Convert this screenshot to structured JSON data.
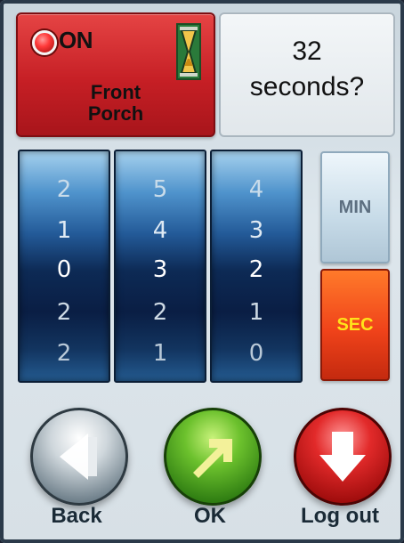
{
  "status": {
    "state_label": "ON",
    "device_name_line1": "Front",
    "device_name_line2": "Porch",
    "power_icon": "power-indicator-icon",
    "timer_icon": "hourglass-icon"
  },
  "question": {
    "line1": "32",
    "line2": "seconds?"
  },
  "wheels": [
    {
      "digits": [
        "2",
        "1",
        "0",
        "2",
        "2"
      ],
      "selected": "0"
    },
    {
      "digits": [
        "5",
        "4",
        "3",
        "2",
        "1"
      ],
      "selected": "3"
    },
    {
      "digits": [
        "4",
        "3",
        "2",
        "1",
        "0"
      ],
      "selected": "2"
    }
  ],
  "units": {
    "min_label": "MIN",
    "sec_label": "SEC",
    "active": "SEC"
  },
  "actions": {
    "back_label": "Back",
    "ok_label": "OK",
    "logout_label": "Log out"
  },
  "colors": {
    "status_active": "#c61f25",
    "sec_active": "#f0431a",
    "sec_text": "#ffe21a",
    "ok_green": "#6cc12d",
    "logout_red": "#e22a2a"
  }
}
